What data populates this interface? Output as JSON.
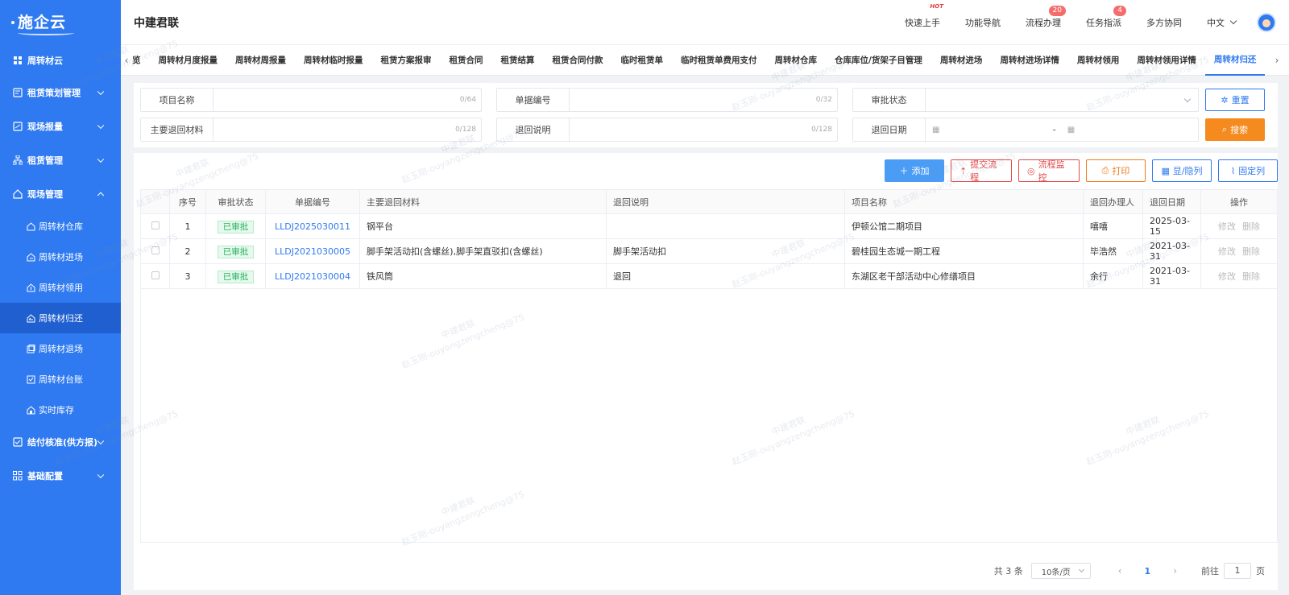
{
  "sidebar": {
    "logo": "施企云",
    "items": [
      {
        "label": "周转材云",
        "icon": "grid-icon"
      },
      {
        "label": "租赁策划管理",
        "icon": "plan-icon"
      },
      {
        "label": "现场报量",
        "icon": "report-icon"
      },
      {
        "label": "租赁管理",
        "icon": "hierarchy-icon"
      },
      {
        "label": "现场管理",
        "icon": "home-icon"
      },
      {
        "label": "结付核准(供方报)",
        "icon": "clipboard-check-icon"
      },
      {
        "label": "基础配置",
        "icon": "apps-icon"
      }
    ],
    "sub_items": [
      {
        "label": "周转材仓库",
        "icon": "warehouse-icon"
      },
      {
        "label": "周转材进场",
        "icon": "entry-icon"
      },
      {
        "label": "周转材领用",
        "icon": "receive-icon"
      },
      {
        "label": "周转材归还",
        "icon": "return-icon"
      },
      {
        "label": "周转材退场",
        "icon": "exit-icon"
      },
      {
        "label": "周转材台账",
        "icon": "ledger-icon"
      },
      {
        "label": "实时库存",
        "icon": "stock-icon"
      }
    ]
  },
  "header": {
    "brand": "中建君联",
    "links": [
      {
        "label": "快速上手",
        "tag": "HOT"
      },
      {
        "label": "功能导航"
      },
      {
        "label": "流程办理",
        "badge": "20"
      },
      {
        "label": "任务指派",
        "badge": "4"
      },
      {
        "label": "多方协同"
      }
    ],
    "language": "中文"
  },
  "tabs": {
    "items": [
      "览",
      "周转材月度报量",
      "周转材周报量",
      "周转材临时报量",
      "租赁方案报审",
      "租赁合同",
      "租赁结算",
      "租赁合同付款",
      "临时租赁单",
      "临时租赁单费用支付",
      "周转材仓库",
      "仓库库位/货架子目管理",
      "周转材进场",
      "周转材进场详情",
      "周转材领用",
      "周转材领用详情",
      "周转材归还"
    ],
    "active_index": 16
  },
  "filter": {
    "project_name": {
      "label": "项目名称",
      "counter": "0/64"
    },
    "doc_no": {
      "label": "单据编号",
      "counter": "0/32"
    },
    "approval_status": {
      "label": "审批状态"
    },
    "main_material": {
      "label": "主要退回材料",
      "counter": "0/128"
    },
    "return_desc": {
      "label": "退回说明",
      "counter": "0/128"
    },
    "return_date": {
      "label": "退回日期",
      "separator": "-"
    },
    "reset_label": "重置",
    "search_label": "搜索"
  },
  "toolbar": {
    "add": "添加",
    "submit_flow": "提交流程",
    "monitor_flow": "流程监控",
    "print": "打印",
    "toggle_cols": "显/隐列",
    "fix_cols": "固定列"
  },
  "table": {
    "headers": [
      "序号",
      "审批状态",
      "单据编号",
      "主要退回材料",
      "退回说明",
      "项目名称",
      "退回办理人",
      "退回日期",
      "操作"
    ],
    "rows": [
      {
        "idx": "1",
        "status": "已审批",
        "doc": "LLDJ2025030011",
        "material": "钢平台",
        "desc": "",
        "project": "伊顿公馆二期项目",
        "handler": "嘻嘻",
        "date": "2025-03-15",
        "edit": "修改",
        "del": "删除"
      },
      {
        "idx": "2",
        "status": "已审批",
        "doc": "LLDJ2021030005",
        "material": "脚手架活动扣(含螺丝),脚手架直驳扣(含螺丝)",
        "desc": "脚手架活动扣",
        "project": "碧桂园生态城一期工程",
        "handler": "毕浩然",
        "date": "2021-03-31",
        "edit": "修改",
        "del": "删除"
      },
      {
        "idx": "3",
        "status": "已审批",
        "doc": "LLDJ2021030004",
        "material": "铁风筒",
        "desc": "退回",
        "project": "东湖区老干部活动中心修缮项目",
        "handler": "余行",
        "date": "2021-03-31",
        "edit": "修改",
        "del": "删除"
      }
    ]
  },
  "pager": {
    "total": "共 3 条",
    "page_size": "10条/页",
    "current": "1",
    "goto_prefix": "前往",
    "goto_value": "1",
    "goto_suffix": "页"
  },
  "watermark": {
    "line1": "中建君联",
    "line2": "赵玉刚-ouyangzengcheng@75"
  },
  "colors": {
    "sidebar": "#2f7af0",
    "accent": "#2f7af0",
    "search": "#f58a1f",
    "approved": "#27b05a"
  }
}
